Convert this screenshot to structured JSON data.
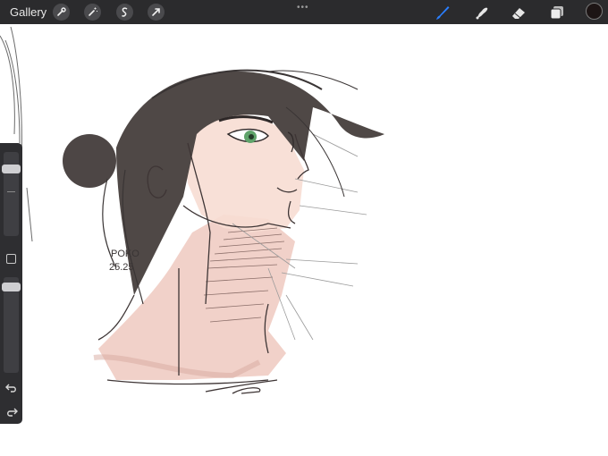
{
  "topbar": {
    "gallery_label": "Gallery",
    "left_tools": [
      "wrench-icon",
      "magic-wand-icon",
      "selection-s-icon",
      "transform-arrow-icon"
    ],
    "more_label": "•••",
    "right_tools": [
      "brush-icon",
      "smudge-icon",
      "eraser-icon",
      "layers-icon"
    ],
    "active_tool": "brush-icon",
    "accent_color": "#2a7fff",
    "current_color": "#1d1515"
  },
  "sidebar": {
    "brush_size_level": 0.88,
    "opacity_level": 0.98,
    "buttons": [
      "modify-square-icon",
      "undo-icon",
      "redo-icon"
    ]
  },
  "artwork": {
    "signature_line1": "POKO",
    "signature_line2": "25.25"
  }
}
